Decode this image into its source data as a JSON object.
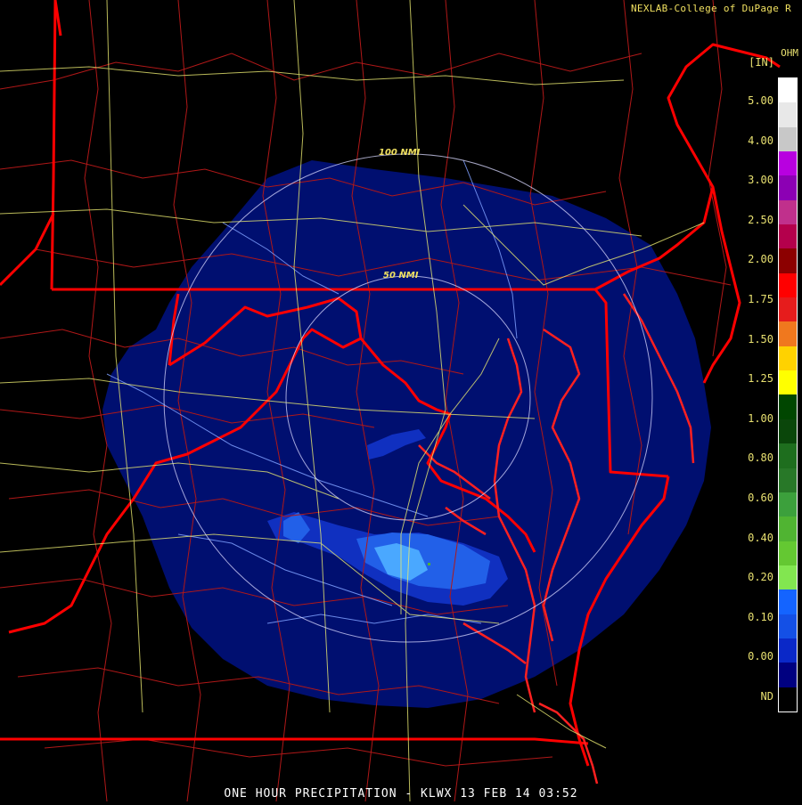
{
  "credit": "NEXLAB-College of DuPage R",
  "product_code": "OHM",
  "units": "[IN]",
  "footer": "ONE HOUR PRECIPITATION - KLWX 13 FEB 14 03:52",
  "range_rings": {
    "inner": "50 NMI",
    "outer": "100 NMI"
  },
  "legend": {
    "labels": [
      "5.00",
      "4.00",
      "3.00",
      "2.50",
      "2.00",
      "1.75",
      "1.50",
      "1.25",
      "1.00",
      "0.80",
      "0.60",
      "0.40",
      "0.20",
      "0.10",
      "0.00",
      "ND"
    ],
    "colors": [
      "#ffffff",
      "#e8e8e8",
      "#c8c8c8",
      "#b800e0",
      "#8c00b4",
      "#c0308c",
      "#b4004c",
      "#8c0000",
      "#ff0000",
      "#e61c1c",
      "#f0781e",
      "#ffd200",
      "#ffff00",
      "#004600",
      "#0a460a",
      "#1e6e1e",
      "#287828",
      "#3ca03c",
      "#50b432",
      "#64c832",
      "#82e650",
      "#1464ff",
      "#1450e6",
      "#0a28c8",
      "#000080",
      "#000000"
    ]
  },
  "colors": {
    "background": "#000000",
    "county": "#b01818",
    "state": "#ff0000",
    "roads": "#e8e870",
    "rivers": "#7fa0ff",
    "rings": "#d8d8ff",
    "echo_base": "#000f70",
    "echo_light": "#1030c0",
    "echo_med": "#2260e8",
    "echo_high": "#4aa8ff"
  }
}
